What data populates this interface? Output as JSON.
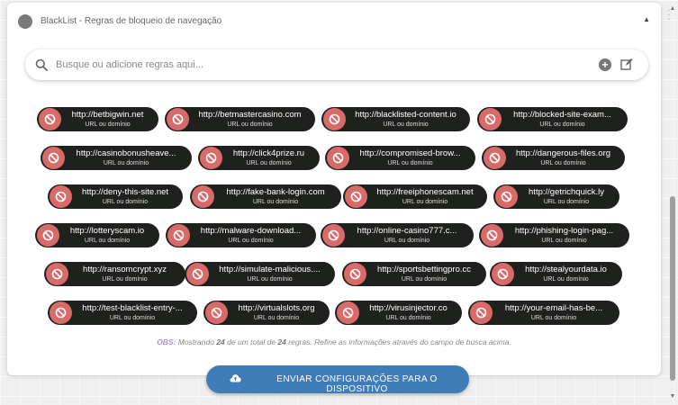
{
  "header": {
    "title": "BlackList - Regras de bloqueio de navegação"
  },
  "search": {
    "placeholder": "Busque ou adicione regras aqui..."
  },
  "rules": [
    {
      "url": "http://betbigwin.net",
      "type": "URL ou domínio"
    },
    {
      "url": "http://betmastercasino.com",
      "type": "URL ou domínio"
    },
    {
      "url": "http://blacklisted-content.io",
      "type": "URL ou domínio"
    },
    {
      "url": "http://blocked-site-exam...",
      "type": "URL ou domínio"
    },
    {
      "url": "http://casinobonusheave...",
      "type": "URL ou domínio"
    },
    {
      "url": "http://click4prize.ru",
      "type": "URL ou domínio"
    },
    {
      "url": "http://compromised-brow...",
      "type": "URL ou domínio"
    },
    {
      "url": "http://dangerous-files.org",
      "type": "URL ou domínio"
    },
    {
      "url": "http://deny-this-site.net",
      "type": "URL ou domínio"
    },
    {
      "url": "http://fake-bank-login.com",
      "type": "URL ou domínio"
    },
    {
      "url": "http://freeiphonescam.net",
      "type": "URL ou domínio"
    },
    {
      "url": "http://getrichquick.ly",
      "type": "URL ou domínio"
    },
    {
      "url": "http://lotteryscam.io",
      "type": "URL ou domínio"
    },
    {
      "url": "http://malware-download...",
      "type": "URL ou domínio"
    },
    {
      "url": "http://online-casino777.c...",
      "type": "URL ou domínio"
    },
    {
      "url": "http://phishing-login-pag...",
      "type": "URL ou domínio"
    },
    {
      "url": "http://ransomcrypt.xyz",
      "type": "URL ou domínio"
    },
    {
      "url": "http://simulate-malicious....",
      "type": "URL ou domínio"
    },
    {
      "url": "http://sportsbettingpro.cc",
      "type": "URL ou domínio"
    },
    {
      "url": "http://stealyourdata.io",
      "type": "URL ou domínio"
    },
    {
      "url": "http://test-blacklist-entry-...",
      "type": "URL ou domínio"
    },
    {
      "url": "http://virtualslots.org",
      "type": "URL ou domínio"
    },
    {
      "url": "http://virusinjector.co",
      "type": "URL ou domínio"
    },
    {
      "url": "http://your-email-has-be...",
      "type": "URL ou domínio"
    }
  ],
  "obs": {
    "label": "OBS:",
    "prefix": "Mostrando",
    "shown": "24",
    "middle": "de um total de",
    "total": "24",
    "suffix": "regras. Refine as informações através do campo de busca acima."
  },
  "footer": {
    "send_label": "ENVIAR CONFIGURAÇÕES PARA O DISPOSITIVO"
  },
  "colors": {
    "pill_bg": "#1f211e",
    "block_icon": "#d96a6a",
    "button": "#3f7cb8",
    "obs_label": "#b88ad9"
  },
  "icons": {
    "back": "arrow-left-icon",
    "menu": "kebab-menu-icon",
    "header": "circle-icon",
    "collapse": "caret-up-icon",
    "search": "search-icon",
    "add": "plus-circle-icon",
    "edit": "edit-icon",
    "rule": "block-icon",
    "send": "cloud-upload-icon"
  }
}
